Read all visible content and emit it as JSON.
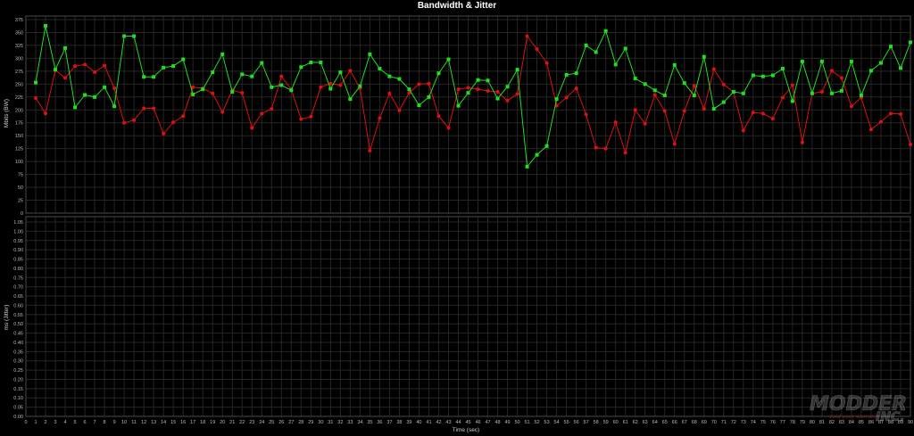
{
  "chart_data": [
    {
      "type": "line",
      "title": "Bandwidth & Jitter",
      "ylabel": "Mbits (BW)",
      "xlabel": "",
      "ylim": [
        0,
        375
      ],
      "yticks": [
        "0",
        "25",
        "50",
        "75",
        "100",
        "125",
        "150",
        "175",
        "200",
        "225",
        "250",
        "275",
        "300",
        "325",
        "350",
        "375"
      ],
      "xlim": [
        0,
        90
      ],
      "grid": true,
      "colors": {
        "green": "#22dd22",
        "red": "#dd1111"
      },
      "series": [
        {
          "color": "#22dd22",
          "marker": "square",
          "x": [
            1,
            2,
            3,
            4,
            5,
            6,
            7,
            8,
            9,
            10,
            11,
            12,
            13,
            14,
            15,
            16,
            17,
            18,
            19,
            20,
            21,
            22,
            23,
            24,
            25,
            26,
            27,
            28,
            29,
            30,
            31,
            32,
            33,
            34,
            35,
            36,
            37,
            38,
            39,
            40,
            41,
            42,
            43,
            44,
            45,
            46,
            47,
            48,
            49,
            50,
            51,
            52,
            53,
            54,
            55,
            56,
            57,
            58,
            59,
            60,
            61,
            62,
            63,
            64,
            65,
            66,
            67,
            68,
            69,
            70,
            71,
            72,
            73,
            74,
            75,
            76,
            77,
            78,
            79,
            80,
            81,
            82,
            83,
            84,
            85,
            86,
            87,
            88,
            89,
            90
          ],
          "values": [
            253,
            363,
            278,
            320,
            205,
            229,
            225,
            244,
            207,
            343,
            343,
            264,
            264,
            282,
            285,
            298,
            230,
            240,
            273,
            308,
            235,
            269,
            265,
            291,
            244,
            248,
            238,
            283,
            292,
            292,
            241,
            273,
            221,
            246,
            308,
            280,
            265,
            260,
            240,
            209,
            225,
            271,
            298,
            208,
            233,
            258,
            257,
            222,
            245,
            278,
            90,
            113,
            130,
            221,
            268,
            271,
            325,
            312,
            353,
            288,
            319,
            261,
            250,
            238,
            228,
            287,
            252,
            228,
            303,
            202,
            215,
            235,
            232,
            267,
            265,
            267,
            280,
            217,
            294,
            232,
            294,
            232,
            237,
            294,
            228,
            276,
            291,
            323,
            281,
            331
          ]
        },
        {
          "color": "#dd1111",
          "marker": "circle",
          "x": [
            1,
            2,
            3,
            4,
            5,
            6,
            7,
            8,
            9,
            10,
            11,
            12,
            13,
            14,
            15,
            16,
            17,
            18,
            19,
            20,
            21,
            22,
            23,
            24,
            25,
            26,
            27,
            28,
            29,
            30,
            31,
            32,
            33,
            34,
            35,
            36,
            37,
            38,
            39,
            40,
            41,
            42,
            43,
            44,
            45,
            46,
            47,
            48,
            49,
            50,
            51,
            52,
            53,
            54,
            55,
            56,
            57,
            58,
            59,
            60,
            61,
            62,
            63,
            64,
            65,
            66,
            67,
            68,
            69,
            70,
            71,
            72,
            73,
            74,
            75,
            76,
            77,
            78,
            79,
            80,
            81,
            82,
            83,
            84,
            85,
            86,
            87,
            88,
            89,
            90
          ],
          "values": [
            223,
            193,
            277,
            262,
            285,
            288,
            273,
            286,
            242,
            175,
            180,
            203,
            203,
            154,
            176,
            188,
            244,
            242,
            232,
            196,
            238,
            233,
            165,
            193,
            202,
            265,
            240,
            182,
            187,
            244,
            251,
            248,
            276,
            242,
            121,
            184,
            232,
            199,
            233,
            250,
            251,
            188,
            165,
            240,
            243,
            240,
            237,
            235,
            218,
            231,
            343,
            318,
            291,
            208,
            224,
            242,
            191,
            127,
            125,
            176,
            117,
            200,
            173,
            229,
            198,
            134,
            198,
            247,
            202,
            279,
            249,
            235,
            160,
            195,
            193,
            183,
            224,
            248,
            137,
            232,
            235,
            276,
            262,
            207,
            224,
            162,
            177,
            193,
            192,
            133
          ]
        }
      ]
    },
    {
      "type": "line",
      "title": "",
      "ylabel": "ms (Jitter)",
      "xlabel": "Time (sec)",
      "ylim": [
        0,
        1.05
      ],
      "yticks": [
        "0.00",
        "0.05",
        "0.10",
        "0.15",
        "0.20",
        "0.25",
        "0.30",
        "0.35",
        "0.40",
        "0.45",
        "0.50",
        "0.55",
        "0.60",
        "0.65",
        "0.70",
        "0.75",
        "0.80",
        "0.85",
        "0.90",
        "0.95",
        "1.00",
        "1.05"
      ],
      "xlim": [
        0,
        90
      ],
      "xticks": [
        "0",
        "1",
        "2",
        "3",
        "4",
        "5",
        "6",
        "7",
        "8",
        "9",
        "10",
        "11",
        "12",
        "13",
        "14",
        "15",
        "16",
        "17",
        "18",
        "19",
        "20",
        "21",
        "22",
        "23",
        "24",
        "25",
        "26",
        "27",
        "28",
        "29",
        "30",
        "31",
        "32",
        "33",
        "34",
        "35",
        "36",
        "37",
        "38",
        "39",
        "40",
        "41",
        "42",
        "43",
        "44",
        "45",
        "46",
        "47",
        "48",
        "49",
        "50",
        "51",
        "52",
        "53",
        "54",
        "55",
        "56",
        "57",
        "58",
        "59",
        "60",
        "61",
        "62",
        "63",
        "64",
        "65",
        "66",
        "67",
        "68",
        "69",
        "70",
        "71",
        "72",
        "73",
        "74",
        "75",
        "76",
        "77",
        "78",
        "79",
        "80",
        "81",
        "82",
        "83",
        "84",
        "85",
        "86",
        "87",
        "88",
        "89",
        "90"
      ],
      "grid": true,
      "series": []
    }
  ],
  "watermark": {
    "main": "MODDERS INC.",
    "sub": "void your warranty"
  }
}
